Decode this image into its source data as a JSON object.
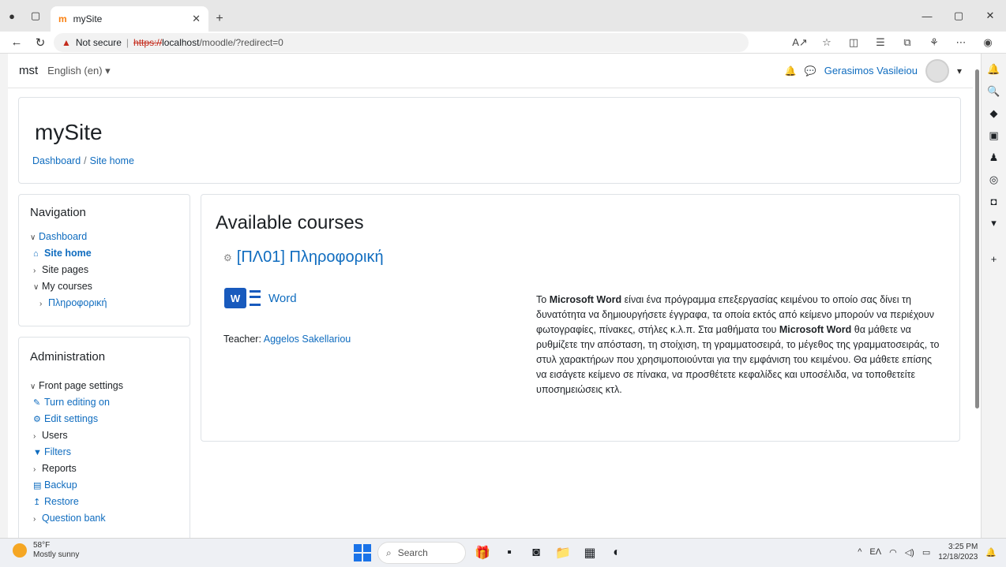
{
  "browser": {
    "tab_title": "mySite",
    "tab_favicon": "m",
    "address": {
      "warning": "Not secure",
      "scheme": "https://",
      "host": "localhost",
      "path": "/moodle/?redirect=0"
    }
  },
  "topnav": {
    "brand": "mst",
    "language": "English (en) ▾",
    "user_name": "Gerasimos Vasileiou"
  },
  "header": {
    "site_title": "mySite",
    "breadcrumb": [
      "Dashboard",
      "Site home"
    ]
  },
  "navigation": {
    "title": "Navigation",
    "items": [
      {
        "label": "Dashboard"
      },
      {
        "label": "Site home"
      },
      {
        "label": "Site pages"
      },
      {
        "label": "My courses"
      },
      {
        "label": "Πληροφορική"
      }
    ]
  },
  "administration": {
    "title": "Administration",
    "items": [
      {
        "label": "Front page settings"
      },
      {
        "label": "Turn editing on"
      },
      {
        "label": "Edit settings"
      },
      {
        "label": "Users"
      },
      {
        "label": "Filters"
      },
      {
        "label": "Reports"
      },
      {
        "label": "Backup"
      },
      {
        "label": "Restore"
      },
      {
        "label": "Question bank"
      }
    ]
  },
  "main": {
    "heading": "Available courses",
    "course": {
      "title": "[ΠΛ01] Πληροφορική",
      "image_label": "Word",
      "teacher_label": "Teacher:",
      "teacher_name": "Aggelos Sakellariou",
      "summary": {
        "p1": "Το ",
        "b1": "Microsoft Word",
        "p2": " είναι ένα πρόγραμμα επεξεργασίας κειμένου το οποίο σας δίνει τη δυνατότητα να δημιουργήσετε  έγγραφα, τα οποία εκτός από κείμενο μπορούν να περιέχουν φωτογραφίες, πίνακες, στήλες κ.λ.π. Στα μαθήματα του ",
        "b2": "Microsoft Word",
        "p3": " θα μάθετε να ρυθμίζετε την απόσταση, τη στοίχιση, τη γραμματοσειρά, το μέγεθος της γραμματοσειράς, το στυλ χαρακτήρων που χρησιμοποιούνται για την εμφάνιση του κειμένου. Θα μάθετε επίσης να εισάγετε κείμενο σε πίνακα, να προσθέτετε κεφαλίδες και υποσέλιδα, να τοποθετείτε υποσημειώσεις κτλ."
      }
    }
  },
  "taskbar": {
    "temp": "58°F",
    "weather": "Mostly sunny",
    "search": "Search",
    "lang": "EΛ",
    "time": "3:25 PM",
    "date": "12/18/2023"
  }
}
